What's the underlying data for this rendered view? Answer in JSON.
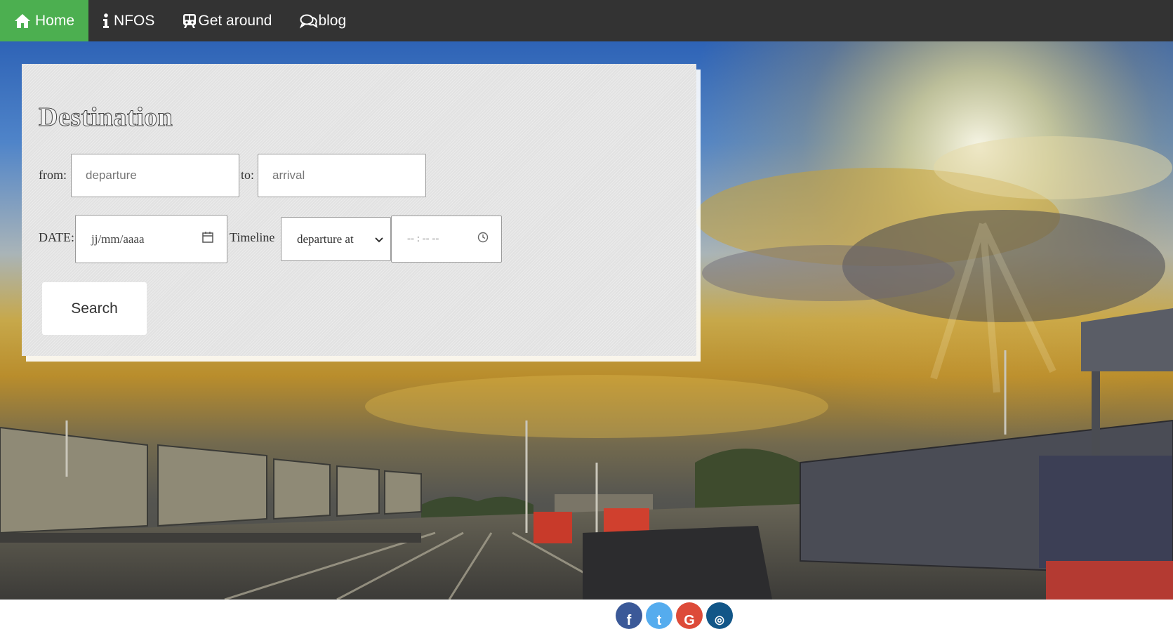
{
  "nav": {
    "items": [
      {
        "label": "Home",
        "icon": "home-icon",
        "active": true
      },
      {
        "label": "NFOS",
        "icon": "info-icon",
        "active": false
      },
      {
        "label": "Get around",
        "icon": "train-icon",
        "active": false
      },
      {
        "label": "blog",
        "icon": "chat-icon",
        "active": false
      }
    ],
    "colors": {
      "bar": "#333333",
      "active": "#4caf50"
    }
  },
  "search": {
    "title": "Destination",
    "from_label": "from:",
    "from_placeholder": "departure",
    "to_label": "to:",
    "to_placeholder": "arrival",
    "date_label": "DATE:",
    "date_placeholder": "jj/mm/aaaa",
    "timeline_label": "Timeline",
    "timeline_selected": "departure at",
    "time_placeholder": "-- : --  --",
    "button_label": "Search"
  },
  "social": [
    {
      "name": "facebook",
      "glyph": "f",
      "color": "#3b5998"
    },
    {
      "name": "twitter",
      "glyph": "t",
      "color": "#55acee"
    },
    {
      "name": "google",
      "glyph": "G",
      "color": "#dd4b39"
    },
    {
      "name": "instagram",
      "glyph": "◎",
      "color": "#125688"
    }
  ]
}
